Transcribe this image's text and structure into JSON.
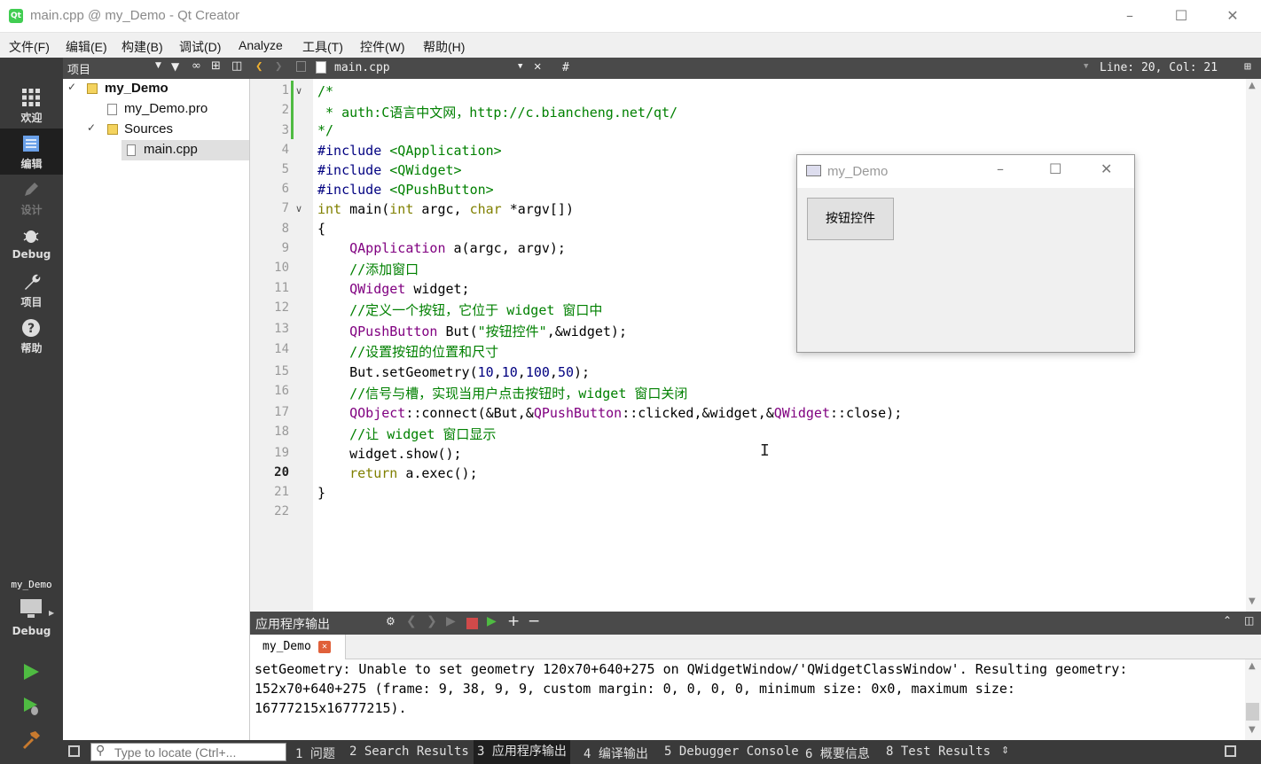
{
  "window": {
    "title": "main.cpp @ my_Demo - Qt Creator",
    "app_icon": "Qt"
  },
  "menu": [
    "文件(F)",
    "编辑(E)",
    "构建(B)",
    "调试(D)",
    "Analyze",
    "工具(T)",
    "控件(W)",
    "帮助(H)"
  ],
  "modes": [
    {
      "label": "欢迎"
    },
    {
      "label": "编辑"
    },
    {
      "label": "设计"
    },
    {
      "label": "Debug"
    },
    {
      "label": "项目"
    },
    {
      "label": "帮助"
    }
  ],
  "kit": {
    "project": "my_Demo",
    "mode": "Debug"
  },
  "navigator": {
    "title": "项目",
    "project": "my_Demo",
    "pro_file": "my_Demo.pro",
    "sources": "Sources",
    "main_file": "main.cpp"
  },
  "editor": {
    "file": "main.cpp",
    "symbol": "#",
    "position": "Line: 20, Col: 21",
    "current_line": "20",
    "line_numbers": [
      "1",
      "2",
      "3",
      "4",
      "5",
      "6",
      "7",
      "8",
      "9",
      "10",
      "11",
      "12",
      "13",
      "14",
      "15",
      "16",
      "17",
      "18",
      "19",
      "20",
      "21",
      "22"
    ]
  },
  "demo_window": {
    "title": "my_Demo",
    "button": "按钮控件"
  },
  "output": {
    "title": "应用程序输出",
    "tab": "my_Demo",
    "lines": [
      "setGeometry: Unable to set geometry 120x70+640+275 on QWidgetWindow/'QWidgetClassWindow'. Resulting geometry:",
      "152x70+640+275 (frame: 9, 38, 9, 9, custom margin: 0, 0, 0, 0, minimum size: 0x0, maximum size:",
      "16777215x16777215)."
    ]
  },
  "status": {
    "locate_placeholder": "Type to locate (Ctrl+...",
    "tabs": [
      "1 问题",
      "2 Search Results",
      "3 应用程序输出",
      "4 编译输出",
      "5 Debugger Console",
      "6 概要信息",
      "8 Test Results"
    ]
  },
  "colors": {
    "sidebar": "#3a3a3a",
    "header": "#4a4a4a",
    "comment": "#008000",
    "keyword": "#808000",
    "type": "#800080",
    "preprocessor": "#000080"
  }
}
